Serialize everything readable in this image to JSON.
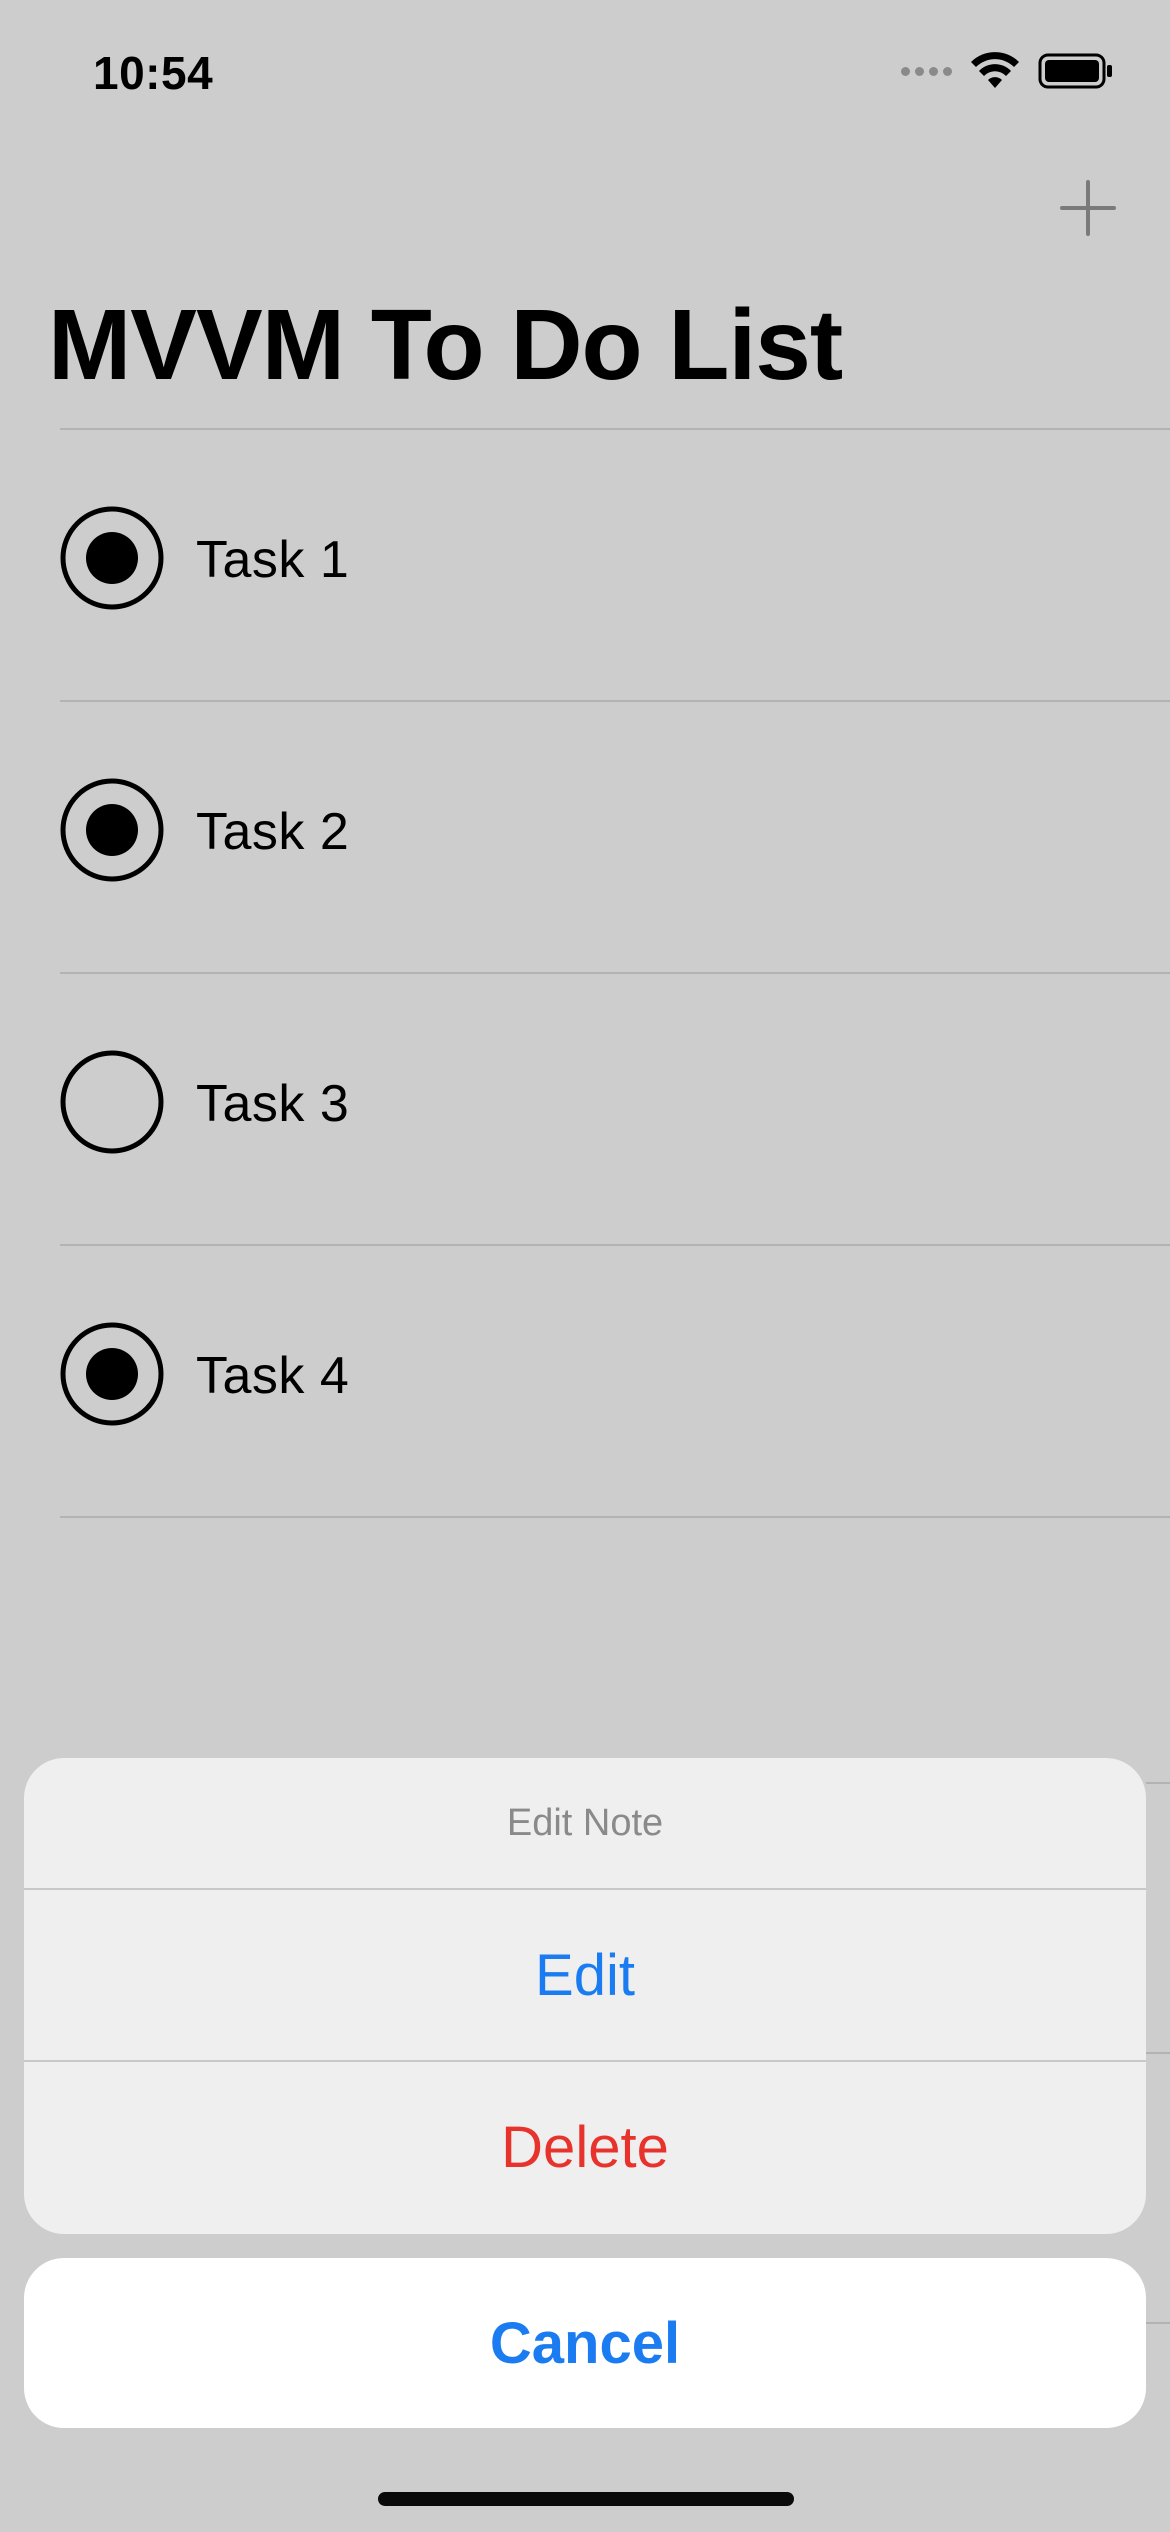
{
  "status_bar": {
    "time": "10:54",
    "signal_icon": "cellular-signal-dots",
    "wifi_icon": "wifi-icon",
    "battery_icon": "battery-full-icon"
  },
  "nav": {
    "add_icon": "plus-icon",
    "title": "MVVM To Do List"
  },
  "tasks": [
    {
      "label": "Task 1",
      "completed": true
    },
    {
      "label": "Task 2",
      "completed": true
    },
    {
      "label": "Task 3",
      "completed": false
    },
    {
      "label": "Task 4",
      "completed": true
    }
  ],
  "action_sheet": {
    "title": "Edit Note",
    "edit_label": "Edit",
    "delete_label": "Delete",
    "cancel_label": "Cancel"
  },
  "colors": {
    "background": "#cdcdcd",
    "accent": "#1a7cf0",
    "destructive": "#e8332c",
    "sheet_background": "#efefef"
  }
}
